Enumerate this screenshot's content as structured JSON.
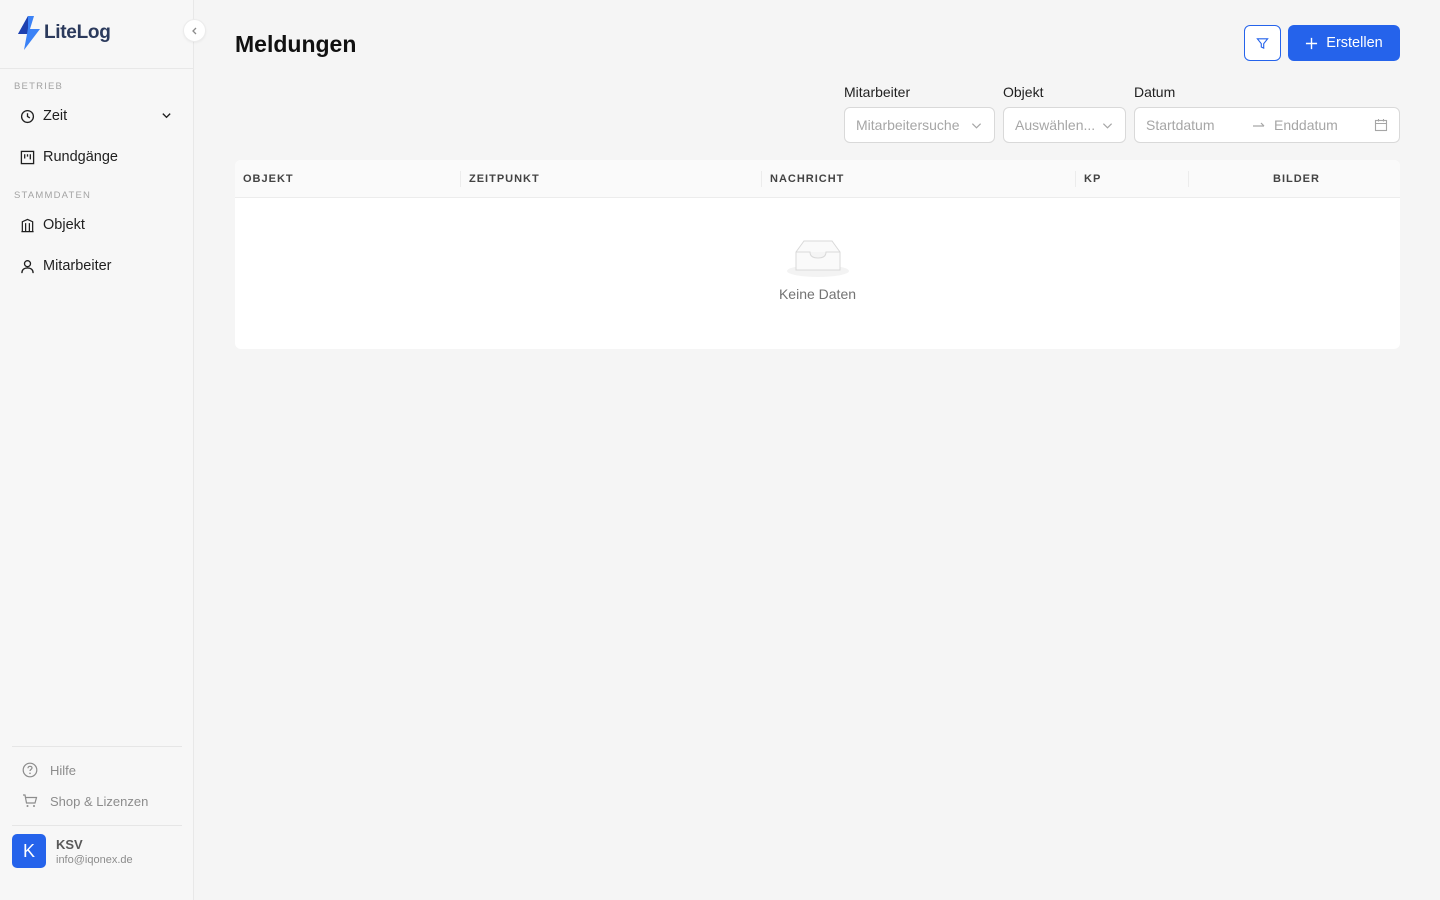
{
  "sidebar": {
    "logo_text": "LiteLog",
    "sections": [
      {
        "label": "BETRIEB"
      },
      {
        "label": "STAMMDATEN"
      }
    ],
    "items": [
      {
        "label": "Zeit",
        "icon": "clock-icon",
        "expandable": true
      },
      {
        "label": "Rundgänge",
        "icon": "board-icon"
      },
      {
        "label": "Objekt",
        "icon": "building-icon"
      },
      {
        "label": "Mitarbeiter",
        "icon": "user-icon"
      }
    ],
    "footer": [
      {
        "label": "Hilfe",
        "icon": "help-icon"
      },
      {
        "label": "Shop & Lizenzen",
        "icon": "cart-icon"
      }
    ],
    "user": {
      "initial": "K",
      "name": "KSV",
      "email": "info@iqonex.de"
    }
  },
  "page": {
    "title": "Meldungen",
    "create_label": "Erstellen"
  },
  "filters": {
    "employee": {
      "label": "Mitarbeiter",
      "placeholder": "Mitarbeitersuche"
    },
    "object": {
      "label": "Objekt",
      "placeholder": "Auswählen..."
    },
    "date": {
      "label": "Datum",
      "start_placeholder": "Startdatum",
      "end_placeholder": "Enddatum"
    }
  },
  "table": {
    "columns": [
      "OBJEKT",
      "ZEITPUNKT",
      "NACHRICHT",
      "KP",
      "BILDER"
    ],
    "rows": [],
    "empty_text": "Keine Daten"
  },
  "colors": {
    "accent": "#2563eb",
    "sidebar_bg": "#f7f7f7",
    "page_bg": "#f5f5f5"
  }
}
